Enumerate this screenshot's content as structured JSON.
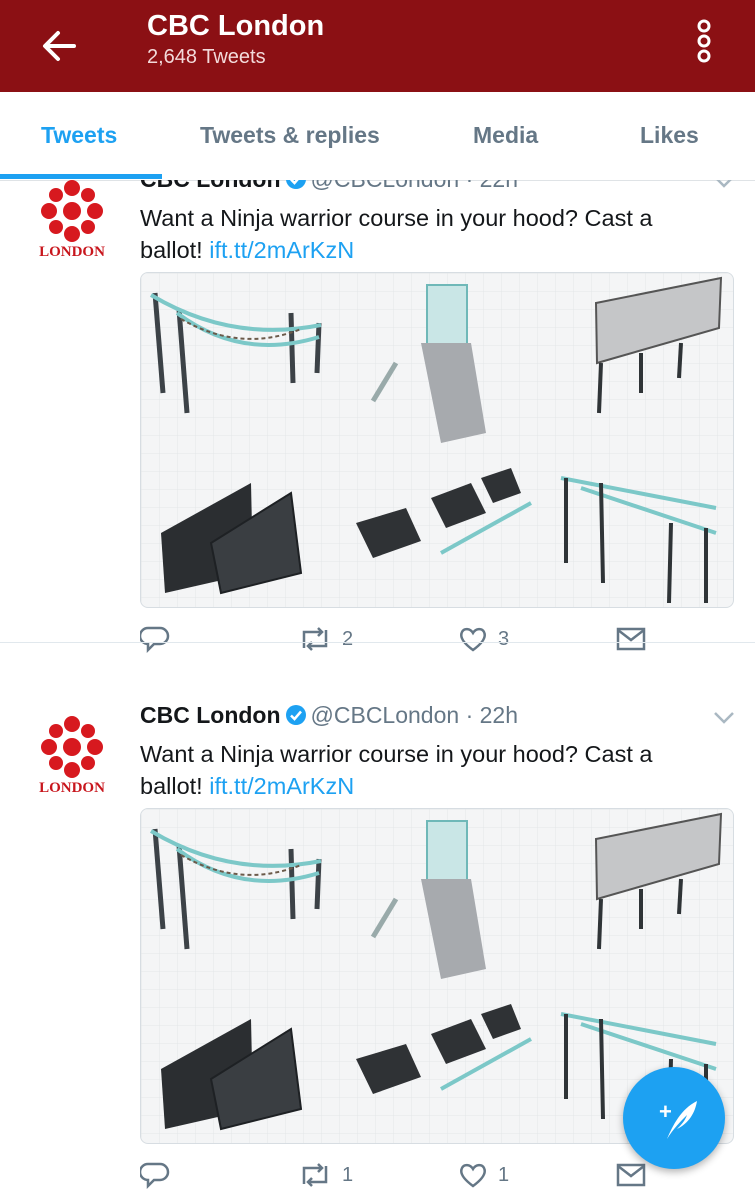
{
  "header": {
    "title": "CBC London",
    "subtitle": "2,648 Tweets",
    "back_icon": "arrow-left-icon",
    "overflow_icon": "overflow-vertical-icon",
    "color": "#8b1014"
  },
  "tabs": [
    {
      "label": "Tweets",
      "active": true
    },
    {
      "label": "Tweets & replies",
      "active": false
    },
    {
      "label": "Media",
      "active": false
    },
    {
      "label": "Likes",
      "active": false
    }
  ],
  "accent": "#1da1f2",
  "tweets": [
    {
      "avatar_text": "LONDON",
      "name": "CBC London",
      "handle": "@CBCLondon",
      "dot": "·",
      "time": "22h",
      "text": "Want a Ninja warrior course in your hood? Cast a ballot! ",
      "link": "ift.tt/2mArKzN",
      "retweets": "2",
      "likes": "3"
    },
    {
      "avatar_text": "LONDON",
      "name": "CBC London",
      "handle": "@CBCLondon",
      "dot": "·",
      "time": "22h",
      "text": "Want a Ninja warrior course in your hood? Cast a ballot! ",
      "link": "ift.tt/2mArKzN",
      "retweets": "1",
      "likes": "1"
    }
  ],
  "fab": {
    "icon": "compose-tweet-icon",
    "plus": "+"
  }
}
